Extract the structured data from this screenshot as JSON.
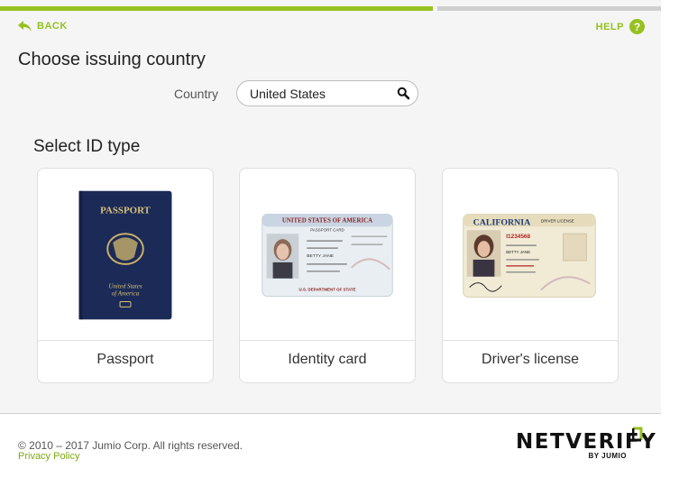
{
  "nav": {
    "back_label": "BACK",
    "help_label": "HELP",
    "help_glyph": "?"
  },
  "progress": {
    "completed_fraction": 0.66
  },
  "title": "Choose issuing country",
  "country": {
    "label": "Country",
    "value": "United States"
  },
  "subtitle": "Select ID type",
  "id_types": [
    {
      "label": "Passport",
      "art": {
        "cover_title": "PASSPORT",
        "cover_sub1": "United States",
        "cover_sub2": "of America"
      }
    },
    {
      "label": "Identity card",
      "art": {
        "header": "UNITED STATES OF AMERICA",
        "subheader": "PASSPORT CARD",
        "name": "BETTY JANE",
        "footer": "U.S. DEPARTMENT OF STATE"
      }
    },
    {
      "label": "Driver's license",
      "art": {
        "header": "CALIFORNIA",
        "subheader": "DRIVER LICENSE",
        "number": "I1234568",
        "name": "BETTY JANE"
      }
    }
  ],
  "footer": {
    "copyright": "© 2010 – 2017 Jumio Corp. All rights reserved.",
    "privacy_label": "Privacy Policy",
    "logo_main": "NETVERIFY",
    "logo_sub": "BY JUMIO"
  },
  "colors": {
    "accent": "#96c11f",
    "progress_track": "#cfcfcf",
    "panel_bg": "#f5f5f5"
  },
  "icons": {
    "back": "back-arrow-icon",
    "help": "help-icon",
    "search": "search-icon"
  }
}
